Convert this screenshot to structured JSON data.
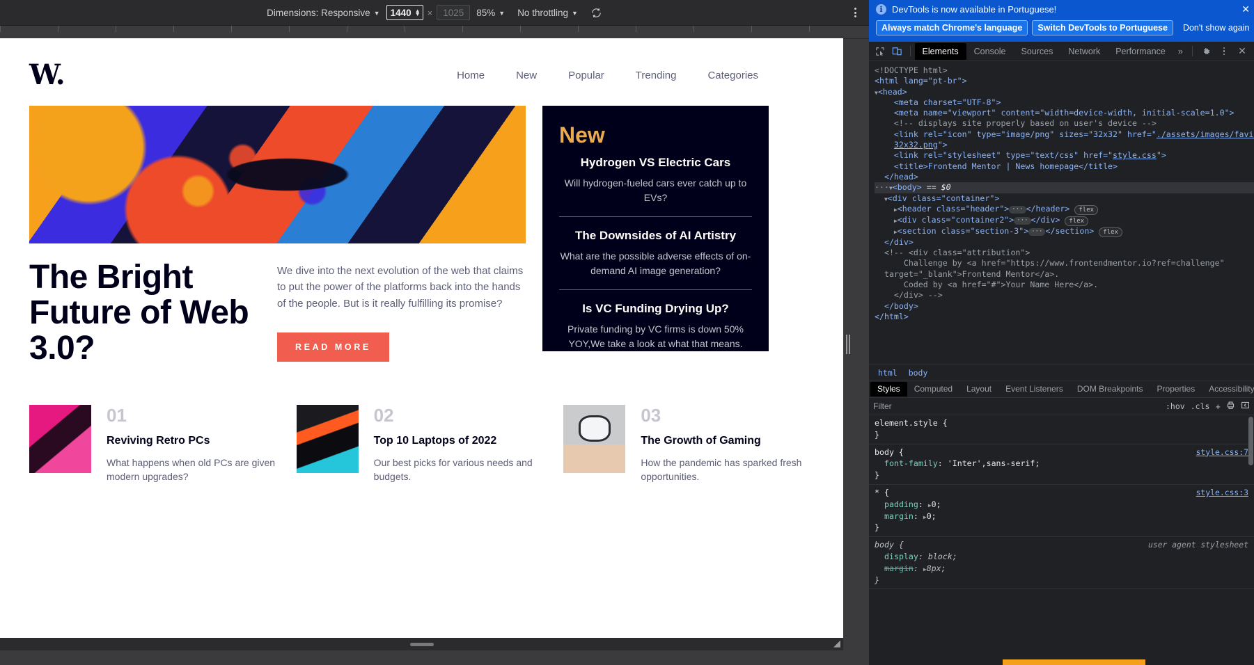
{
  "device_toolbar": {
    "dimensions_label": "Dimensions: Responsive",
    "caret": "▼",
    "width_value": "1440",
    "separator": "×",
    "height_placeholder": "1025",
    "zoom_label": "85%",
    "throttling_label": "No throttling",
    "rotate_icon": "rotate-icon",
    "kebab_icon": "more-options-icon"
  },
  "page": {
    "logo": "W.",
    "nav": [
      {
        "label": "Home"
      },
      {
        "label": "New"
      },
      {
        "label": "Popular"
      },
      {
        "label": "Trending"
      },
      {
        "label": "Categories"
      }
    ],
    "hero": {
      "title": "The Bright Future of Web 3.0?",
      "paragraph": "We dive into the next evolution of the web that claims to put the power of the platforms back into the hands of the people. But is it really fulfilling its promise?",
      "cta": "READ MORE"
    },
    "new_panel": {
      "title": "New",
      "items": [
        {
          "heading": "Hydrogen VS Electric Cars",
          "desc": "Will hydrogen-fueled cars ever catch up to EVs?"
        },
        {
          "heading": "The Downsides of AI Artistry",
          "desc": "What are the possible adverse effects of on-demand AI image generation?"
        },
        {
          "heading": "Is VC Funding Drying Up?",
          "desc": "Private funding by VC firms is down 50% YOY,We take a look at what that means."
        }
      ]
    },
    "cards": [
      {
        "number": "01",
        "heading": "Reviving Retro PCs",
        "desc": "What happens when old PCs are given modern upgrades?"
      },
      {
        "number": "02",
        "heading": "Top 10 Laptops of 2022",
        "desc": "Our best picks for various needs and budgets."
      },
      {
        "number": "03",
        "heading": "The Growth of Gaming",
        "desc": "How the pandemic has sparked fresh opportunities."
      }
    ]
  },
  "devtools": {
    "banner": {
      "message": "DevTools is now available in Portuguese!",
      "btn_always": "Always match Chrome's language",
      "btn_switch": "Switch DevTools to Portuguese",
      "btn_dismiss": "Don't show again",
      "close": "✕"
    },
    "tabs": [
      {
        "label": "Elements",
        "active": true
      },
      {
        "label": "Console",
        "active": false
      },
      {
        "label": "Sources",
        "active": false
      },
      {
        "label": "Network",
        "active": false
      },
      {
        "label": "Performance",
        "active": false
      }
    ],
    "tabs_overflow": "»",
    "breadcrumb": [
      {
        "label": "html"
      },
      {
        "label": "body"
      }
    ],
    "style_tabs": [
      {
        "label": "Styles",
        "active": true
      },
      {
        "label": "Computed",
        "active": false
      },
      {
        "label": "Layout",
        "active": false
      },
      {
        "label": "Event Listeners",
        "active": false
      },
      {
        "label": "DOM Breakpoints",
        "active": false
      },
      {
        "label": "Properties",
        "active": false
      },
      {
        "label": "Accessibility",
        "active": false
      }
    ],
    "filter": {
      "placeholder": "Filter",
      "hov": ":hov",
      "cls": ".cls",
      "plus": "+"
    },
    "dom": {
      "doctype": "<!DOCTYPE html>",
      "html_open": "<html lang=\"pt-br\">",
      "head_open": "<head>",
      "meta_charset": "<meta charset=\"UTF-8\">",
      "meta_viewport": "<meta name=\"viewport\" content=\"width=device-width, initial-scale=1.0\">",
      "comment_display": "<!-- displays site properly based on user's device -->",
      "link_icon_part1": "<link rel=\"icon\" type=\"image/png\" sizes=\"32x32\" href=\"",
      "link_icon_href": "./assets/images/favicon-",
      "link_icon_href2": "32x32.png",
      "link_icon_part2": "\">",
      "link_style_part1": "<link rel=\"stylesheet\" type=\"text/css\" href=\"",
      "link_style_href": "style.css",
      "link_style_part2": "\">",
      "title_line": "<title>Frontend Mentor | News homepage</title>",
      "head_close": "</head>",
      "body_open": "<body>",
      "body_sel": "== $0",
      "div_container": "<div class=\"container\">",
      "header_line": "<header class=\"header\">",
      "header_close": "</header>",
      "container2_line": "<div class=\"container2\">",
      "container2_close": "</div>",
      "section3_line": "<section class=\"section-3\">",
      "section3_close": "</section>",
      "flex_badge": "flex",
      "div_close": "</div>",
      "attr_comment_1": "<!-- <div class=\"attribution\">",
      "attr_comment_2": "Challenge by <a href=\"https://www.frontendmentor.io?ref=challenge\"",
      "attr_comment_3": "target=\"_blank\">Frontend Mentor</a>.",
      "attr_comment_4": "Coded by <a href=\"#\">Your Name Here</a>.",
      "attr_comment_5": "</div> -->",
      "body_close": "</body>",
      "html_close": "</html>"
    },
    "css_rules": [
      {
        "selector": "element.style {",
        "source": "",
        "declarations": [],
        "close": "}"
      },
      {
        "selector": "body {",
        "source": "style.css:7",
        "declarations": [
          {
            "prop": "font-family",
            "value": "'Inter',sans-serif;"
          }
        ],
        "close": "}"
      },
      {
        "selector": "* {",
        "source": "style.css:3",
        "declarations": [
          {
            "prop": "padding",
            "value": "0;"
          },
          {
            "prop": "margin",
            "value": "0;"
          }
        ],
        "close": "}"
      },
      {
        "selector": "body {",
        "source": "user agent stylesheet",
        "declarations": [
          {
            "prop": "display",
            "value": "block;"
          },
          {
            "prop": "margin",
            "value": "8px;",
            "struck": true
          }
        ],
        "close": "}"
      }
    ]
  }
}
